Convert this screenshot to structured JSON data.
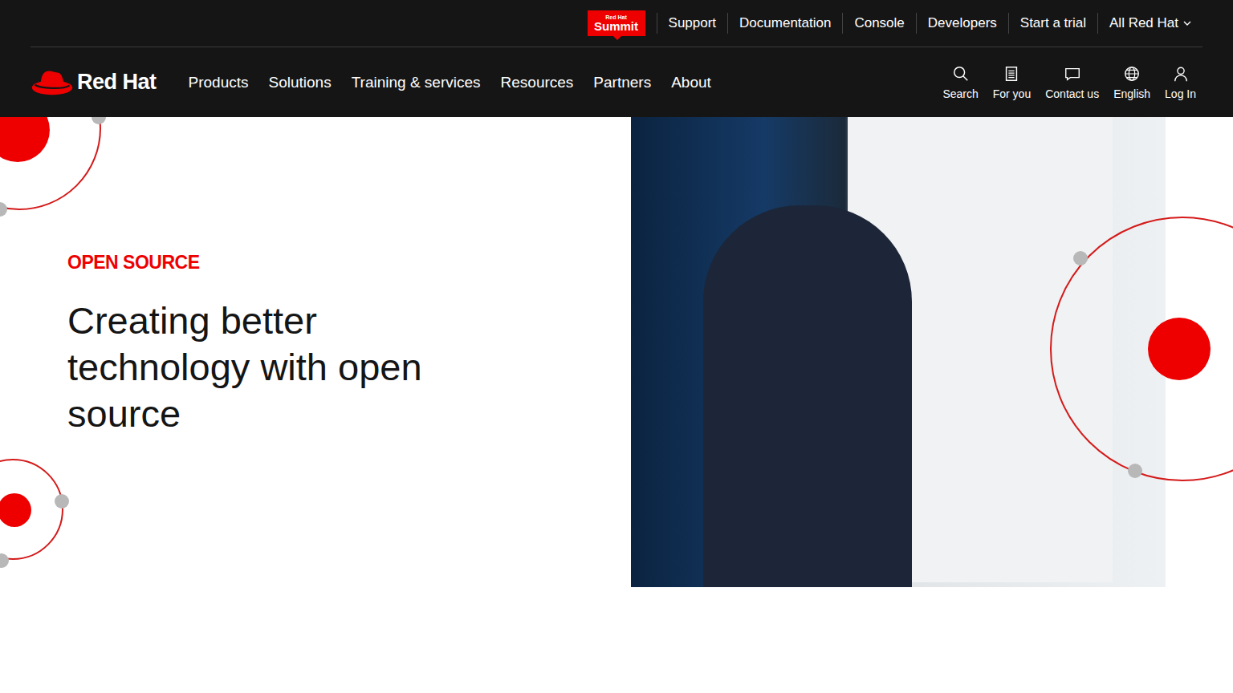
{
  "header": {
    "summit_badge": {
      "small": "Red Hat",
      "main": "Summit"
    },
    "utility_links": [
      "Support",
      "Documentation",
      "Console",
      "Developers",
      "Start a trial",
      "All Red Hat"
    ],
    "logo": "Red Hat",
    "nav": [
      "Products",
      "Solutions",
      "Training & services",
      "Resources",
      "Partners",
      "About"
    ],
    "actions": [
      {
        "label": "Search",
        "icon": "search"
      },
      {
        "label": "For you",
        "icon": "document"
      },
      {
        "label": "Contact us",
        "icon": "chat"
      },
      {
        "label": "English",
        "icon": "globe"
      },
      {
        "label": "Log In",
        "icon": "user"
      }
    ]
  },
  "hero": {
    "eyebrow": "OPEN SOURCE",
    "heading": "Creating better technology with open source"
  }
}
